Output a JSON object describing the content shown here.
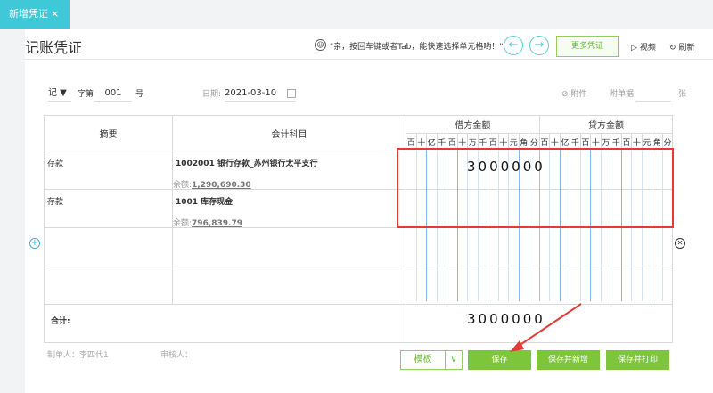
{
  "tab": {
    "label": "新增凭证",
    "close": "×"
  },
  "page": {
    "title": "记账凭证"
  },
  "tip": {
    "icon": "☺",
    "text": "\"亲，按回车键或者Tab，能快速选择单元格哟！\""
  },
  "nav": {
    "prev": "←",
    "next": "→"
  },
  "toolbar": {
    "more_label": "更多凭证",
    "video_label": "视频",
    "refresh_label": "刷新",
    "video_icon": "▷",
    "refresh_icon": "↻"
  },
  "header": {
    "voucher_word": "记 ▼",
    "zi_label": "字第",
    "number": "001",
    "hao_label": "号",
    "date_label": "日期:",
    "date_value": "2021-03-10",
    "attach_label": "附件",
    "doc_count_label": "附单据",
    "zhang_label": "张"
  },
  "table": {
    "col_summary": "摘要",
    "col_account": "会计科目",
    "col_debit": "借方金额",
    "col_credit": "贷方金额",
    "digits": [
      "百",
      "十",
      "亿",
      "千",
      "百",
      "十",
      "万",
      "千",
      "百",
      "十",
      "元",
      "角",
      "分"
    ],
    "rows": [
      {
        "summary": "存款",
        "account": "1002001 银行存款_苏州银行太平支行",
        "balance_label": "余额:",
        "balance": "1,290,690.30"
      },
      {
        "summary": "存款",
        "account": "1001 库存现金",
        "balance_label": "余额:",
        "balance": "796,839.79"
      }
    ],
    "debit_amount": "3000000",
    "total_label": "合计:",
    "total_amount": "3000000"
  },
  "footer": {
    "maker_label": "制单人：李四代1",
    "reviewer_label": "审核人："
  },
  "buttons": {
    "template": "模板",
    "template_caret": "∨",
    "save": "保存",
    "save_new": "保存并新增",
    "save_print": "保存并打印"
  },
  "colors": {
    "accent": "#3fc8d8",
    "green": "#7dc63b",
    "highlight": "#e53935"
  }
}
